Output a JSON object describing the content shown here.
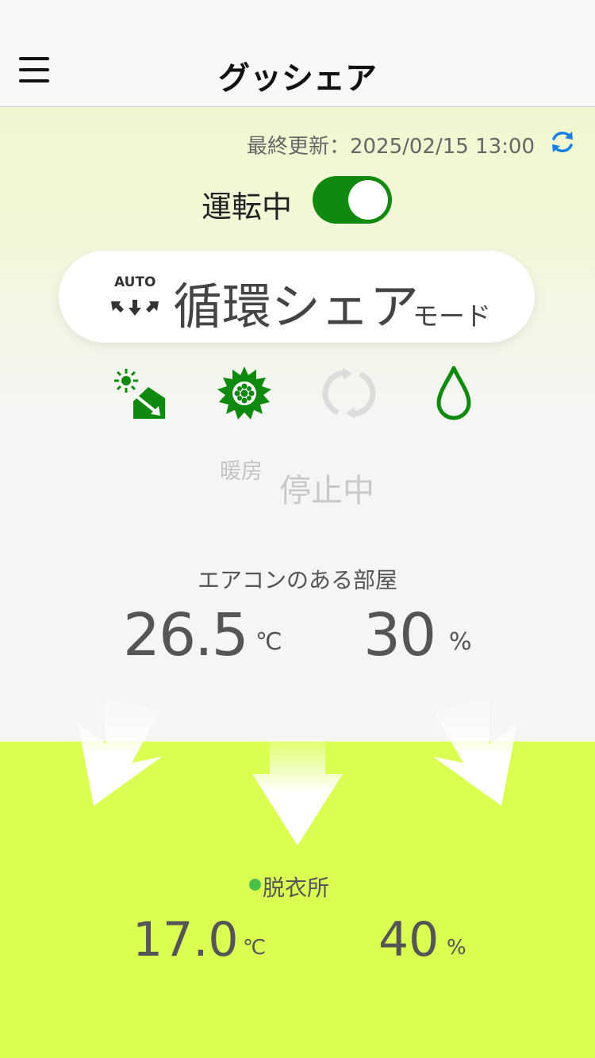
{
  "header": {
    "title": "グッシェア"
  },
  "status": {
    "last_update": "最終更新：2025/02/15 13:00",
    "running_label": "運転中",
    "running": true
  },
  "mode": {
    "auto_label": "AUTO",
    "name": "循環シェア",
    "suffix": "モード"
  },
  "operation": {
    "mode_label": "暖房",
    "state_label": "停止中"
  },
  "source_room": {
    "label": "エアコンのある部屋",
    "temperature": "26.5",
    "temperature_unit": "℃",
    "humidity": "30",
    "humidity_unit": "%"
  },
  "destination_room": {
    "label": "脱衣所",
    "temperature": "17.0",
    "temperature_unit": "℃",
    "humidity": "40",
    "humidity_unit": "%"
  },
  "colors": {
    "accent_green": "#0f8a0f",
    "background_lime": "#daff52",
    "sync_blue": "#1a7fe0"
  },
  "icons": [
    "menu-icon",
    "refresh-icon",
    "sun-house-icon",
    "gear-icon",
    "cycle-icon",
    "water-drop-icon",
    "auto-arrows-icon"
  ]
}
